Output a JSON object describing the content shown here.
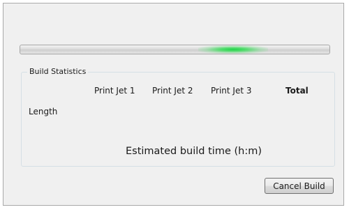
{
  "progress": {
    "state": "indeterminate",
    "accent_color": "#21d24a"
  },
  "build_statistics": {
    "group_label": "Build Statistics",
    "columns": [
      "Print Jet 1",
      "Print Jet 2",
      "Print Jet 3",
      "Total"
    ],
    "rows": [
      {
        "label": "Length"
      }
    ],
    "estimated_time_label": "Estimated build time (h:m)"
  },
  "actions": {
    "cancel_label": "Cancel Build"
  }
}
